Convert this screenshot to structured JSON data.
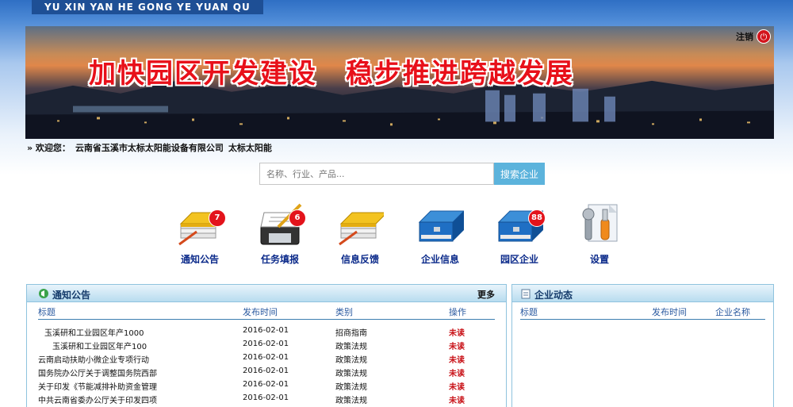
{
  "header": {
    "site_name": "YU XIN YAN HE GONG YE YUAN QU",
    "slogan": "加快园区开发建设　稳步推进跨越发展",
    "logout_label": "注销"
  },
  "welcome": {
    "prefix": "» 欢迎您：",
    "company": "云南省玉溪市太标太阳能设备有限公司",
    "brand": "太标太阳能"
  },
  "search": {
    "placeholder": "名称、行业、产品...",
    "button_label": "搜索企业"
  },
  "nav": [
    {
      "label": "通知公告",
      "badge": "7",
      "icon": "document-stack-icon"
    },
    {
      "label": "任务填报",
      "badge": "6",
      "icon": "edit-form-icon"
    },
    {
      "label": "信息反馈",
      "badge": "",
      "icon": "document-stack-icon"
    },
    {
      "label": "企业信息",
      "badge": "",
      "icon": "blue-binder-icon"
    },
    {
      "label": "园区企业",
      "badge": "88",
      "icon": "blue-binder-icon"
    },
    {
      "label": "设置",
      "badge": "",
      "icon": "settings-tools-icon"
    }
  ],
  "notice_panel": {
    "title": "通知公告",
    "more": "更多",
    "columns": [
      "标题",
      "发布时间",
      "类别",
      "操作"
    ],
    "rows": [
      {
        "title": "玉溪研和工业园区年产1000",
        "date": "2016-02-01",
        "category": "招商指南",
        "status": "未读"
      },
      {
        "title": "玉溪研和工业园区年产100",
        "date": "2016-02-01",
        "category": "政策法规",
        "status": "未读"
      },
      {
        "title": "云南启动扶助小微企业专项行动",
        "date": "2016-02-01",
        "category": "政策法规",
        "status": "未读"
      },
      {
        "title": "国务院办公厅关于调整国务院西部",
        "date": "2016-02-01",
        "category": "政策法规",
        "status": "未读"
      },
      {
        "title": "关于印发《节能减排补助资金管理",
        "date": "2016-02-01",
        "category": "政策法规",
        "status": "未读"
      },
      {
        "title": "中共云南省委办公厅关于印发四项",
        "date": "2016-02-01",
        "category": "政策法规",
        "status": "未读"
      }
    ]
  },
  "news_panel": {
    "title": "企业动态",
    "columns": [
      "标题",
      "发布时间",
      "企业名称"
    ]
  },
  "colors": {
    "accent": "#5cb3dc",
    "badge": "#e3131b",
    "slogan": "#e8101a",
    "nav_label": "#0b2a8a"
  }
}
